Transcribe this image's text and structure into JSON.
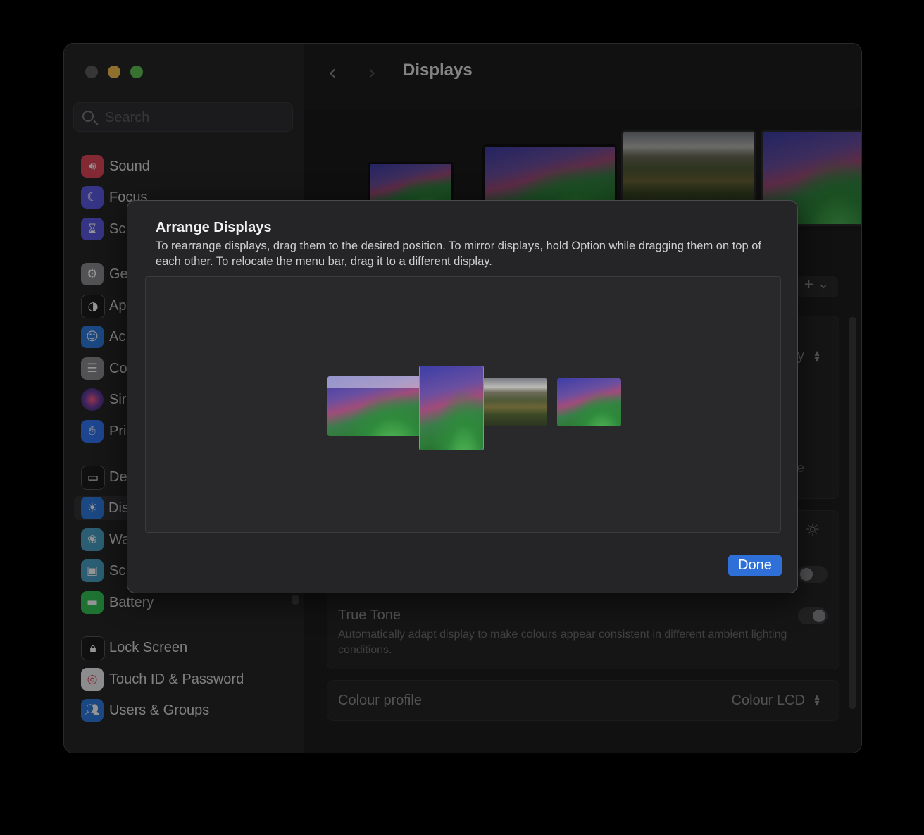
{
  "sidebar": {
    "search_placeholder": "Search",
    "items": [
      {
        "label": "Sound",
        "icon": "speaker-icon",
        "color": "#e0475a"
      },
      {
        "label": "Focus",
        "icon": "moon-icon",
        "color": "#5e5ce6"
      },
      {
        "label": "Sc",
        "icon": "hourglass-icon",
        "color": "#5e5ce6"
      },
      {
        "label": "Ge",
        "icon": "gear-icon",
        "color": "#8e8e93"
      },
      {
        "label": "Ap",
        "icon": "appearance-icon",
        "color": "#1c1c1e"
      },
      {
        "label": "Ac",
        "icon": "accessibility-icon",
        "color": "#2f7de1"
      },
      {
        "label": "Co",
        "icon": "control-center-icon",
        "color": "#8e8e93"
      },
      {
        "label": "Sir",
        "icon": "siri-icon",
        "color": "#6b3fa0"
      },
      {
        "label": "Pri",
        "icon": "hand-icon",
        "color": "#3478f6"
      },
      {
        "label": "De",
        "icon": "desktop-dock-icon",
        "color": "#1c1c1e"
      },
      {
        "label": "Dis",
        "icon": "sun-icon",
        "color": "#2f7de1"
      },
      {
        "label": "Wa",
        "icon": "wallpaper-icon",
        "color": "#4aa3c7"
      },
      {
        "label": "Sc",
        "icon": "screensaver-icon",
        "color": "#4aa3c7"
      },
      {
        "label": "Battery",
        "icon": "battery-icon",
        "color": "#34c759"
      },
      {
        "label": "Lock Screen",
        "icon": "lock-icon",
        "color": "#1c1c1e"
      },
      {
        "label": "Touch ID & Password",
        "icon": "fingerprint-icon",
        "color": "#f2f2f7"
      },
      {
        "label": "Users & Groups",
        "icon": "users-icon",
        "color": "#2f7de1"
      }
    ]
  },
  "main": {
    "title": "Displays",
    "back_glyph": "‹",
    "forward_glyph": "›",
    "add_glyph": "+ ⌄",
    "true_tone": {
      "title": "True Tone",
      "description": "Automatically adapt display to make colours appear consistent in different ambient lighting conditions."
    },
    "colour_profile": {
      "label": "Colour profile",
      "value": "Colour LCD"
    },
    "partial_y": "y",
    "partial_e": "e"
  },
  "dialog": {
    "title": "Arrange Displays",
    "description": "To rearrange displays, drag them to the desired position. To mirror displays, hold Option while dragging them on top of each other. To relocate the menu bar, drag it to a different display.",
    "done_label": "Done"
  },
  "colors": {
    "accent": "#2e6fd8",
    "traffic_close": "#5d5d5f",
    "traffic_minimize": "#f4bf4f",
    "traffic_maximize": "#61c554"
  }
}
